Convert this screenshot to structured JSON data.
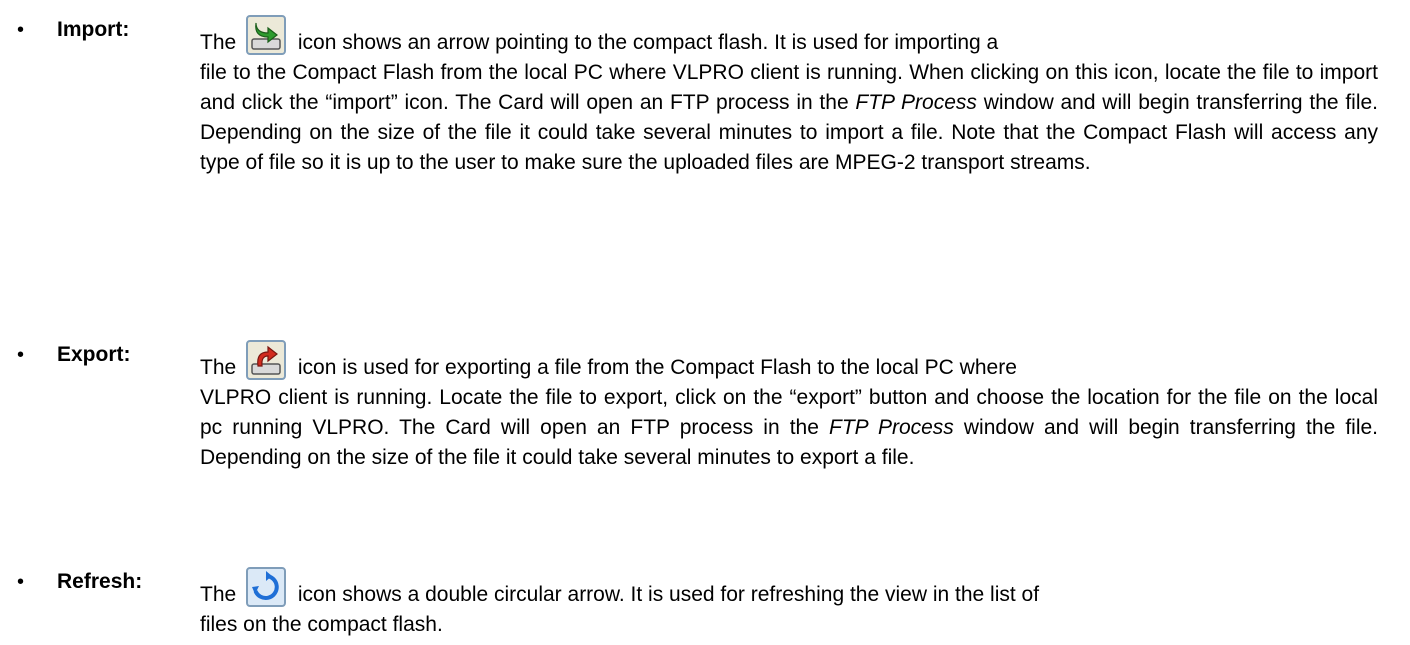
{
  "items": [
    {
      "term": "Import:",
      "icon": "import-icon",
      "lead_before_icon": "The",
      "lead_after_icon": "icon shows an arrow pointing to the compact flash. It is used for importing a",
      "rest_part1": "file to the Compact Flash from the local PC where VLPRO client is running. When clicking on this icon, locate the file to import and click the “import” icon. The Card will open an FTP process in the",
      "rest_em": "FTP Process",
      "rest_part2": "window and will begin transferring the file. Depending on the size of the file it could take several minutes to import a file. Note that the Compact Flash will access any type of file so it is up to the user to make sure the uploaded files are MPEG-2 transport streams."
    },
    {
      "term": "Export:",
      "icon": "export-icon",
      "lead_before_icon": "The",
      "lead_after_icon": "icon is used for exporting a file from the Compact Flash to the local PC where",
      "rest_part1": "VLPRO client is running. Locate the file to export, click on the “export” button and choose the location for the file on the local pc running VLPRO. The Card will open an FTP process in the",
      "rest_em": "FTP Process",
      "rest_part2": "window and will begin transferring the file. Depending on the size of the file it could take several minutes to export a file."
    },
    {
      "term": "Refresh:",
      "icon": "refresh-icon",
      "lead_before_icon": "The",
      "lead_after_icon": "icon shows a double circular arrow. It is used for refreshing the view in the list of",
      "rest_part1": "files on the compact flash."
    }
  ],
  "colors": {
    "icon_frame": "#7f9db9",
    "icon_bg": "#ece9d8",
    "import_arrow": "#2e9b2e",
    "export_arrow": "#d22b1e",
    "refresh_arrow": "#1f6fd6"
  }
}
